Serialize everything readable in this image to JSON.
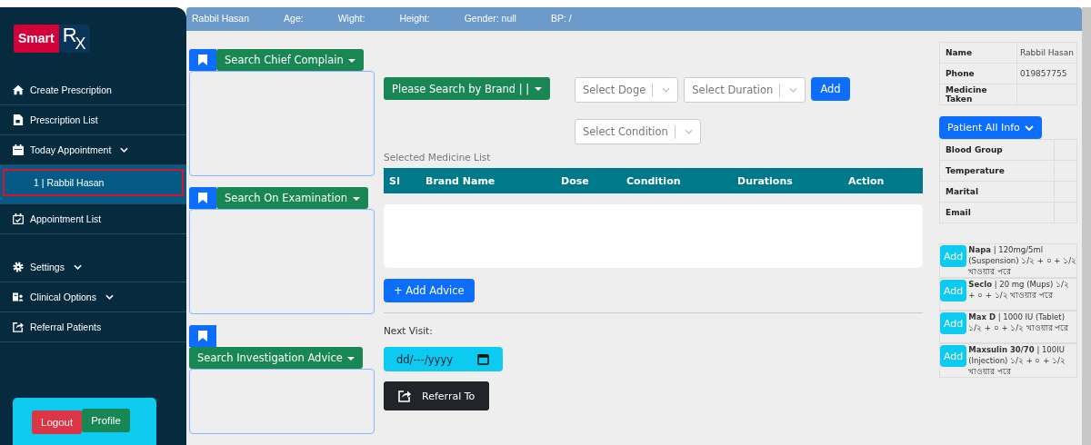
{
  "logo": {
    "word": "Smart",
    "mark": "R",
    "sub": "X"
  },
  "sidebar": {
    "groups": [
      [
        {
          "label": "Create Prescription",
          "kind": "link"
        },
        {
          "label": "Prescription List",
          "kind": "link"
        },
        {
          "label": "Today Appointment",
          "kind": "menu",
          "children": [
            {
              "label": "1 | Rabbil Hasan",
              "selected": true
            }
          ]
        },
        {
          "label": "Appointment List",
          "kind": "link"
        }
      ],
      [
        {
          "label": "Settings",
          "kind": "menu"
        },
        {
          "label": "Clinical Options",
          "kind": "menu"
        },
        {
          "label": "Referral Patients",
          "kind": "link"
        }
      ]
    ],
    "buttons": [
      "Logout",
      "Profile"
    ]
  },
  "header": [
    "Rabbil Hasan",
    "Age:",
    "Wight:",
    "Height:",
    "Gender: null",
    "BP: /"
  ],
  "left_sections": [
    {
      "button": "Search Chief Complain"
    },
    {
      "button": "Search On Examination"
    },
    {
      "button": "Search Investigation Advice"
    }
  ],
  "brand_button": "Please Search by Brand | |",
  "selects": [
    {
      "placeholder": "Select Doge"
    },
    {
      "placeholder": "Select Duration"
    },
    {
      "placeholder": "Select Condition"
    }
  ],
  "add_button": "Add",
  "medicine_list": {
    "title": "Selected Medicine List",
    "columns": [
      "SI",
      "Brand Name",
      "Dose",
      "Condition",
      "Durations",
      "Action"
    ]
  },
  "add_advice": "+ Add Advice",
  "next_visit": {
    "label": "Next Visit:",
    "placeholder": "dd/---/yyyy"
  },
  "referral_button": "Referral To",
  "patient_table": [
    {
      "label": "Name",
      "value": "Rabbil Hasan"
    },
    {
      "label": "Phone",
      "value": "019857755"
    },
    {
      "label": "Medicine Taken"
    }
  ],
  "all_info_button": "Patient All Info",
  "info_table": [
    "Blood Group",
    "Temperature",
    "Marital",
    "Email"
  ],
  "suggestions": [
    {
      "button": "Add",
      "text": "**Napa** | 120mg/5ml (Suspension) ১/২ + ০ + ১/২ খাওয়ার পরে"
    },
    {
      "button": "Add",
      "text": "**Seclo** | 20 mg (Mups) ১/২ + ০ + ১/২ খাওয়ার পরে"
    },
    {
      "button": "Add",
      "text": "**Max D** | 1000 IU (Tablet) ১/২ + ০ + ১/২ খাওয়ার পরে"
    },
    {
      "button": "Add",
      "text": "**Maxsulin 30/70** | 100IU (Injection) ১/২ + ০ + ১/২ খাওয়ার পরে"
    }
  ]
}
